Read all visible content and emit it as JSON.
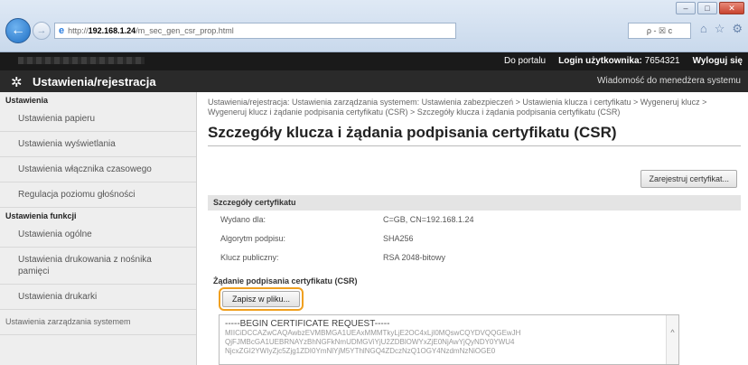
{
  "browser": {
    "url_prefix": "http://",
    "url_host": "192.168.1.24",
    "url_path": "/m_sec_gen_csr_prop.html",
    "address_tools": "ρ - ☒ c"
  },
  "topbar": {
    "portal_link": "Do portalu",
    "login_label": "Login użytkownika:",
    "login_value": "7654321",
    "logout": "Wyloguj się"
  },
  "header": {
    "title": "Ustawienia/rejestracja",
    "admin_message": "Wiadomość do menedżera systemu"
  },
  "sidebar": {
    "sections": [
      {
        "heading": "Ustawienia",
        "items": [
          "Ustawienia papieru",
          "Ustawienia wyświetlania",
          "Ustawienia włącznika czasowego",
          "Regulacja poziomu głośności"
        ]
      },
      {
        "heading": "Ustawienia funkcji",
        "items": [
          "Ustawienia ogólne",
          "Ustawienia drukowania z nośnika pamięci",
          "Ustawienia drukarki"
        ]
      }
    ],
    "bottom_item": "Ustawienia zarządzania systemem"
  },
  "main": {
    "breadcrumb": "Ustawienia/rejestracja: Ustawienia zarządzania systemem: Ustawienia zabezpieczeń > Ustawienia klucza i certyfikatu > Wygeneruj klucz > Wygeneruj klucz i żądanie podpisania certyfikatu (CSR) > Szczegóły klucza i żądania podpisania certyfikatu (CSR)",
    "page_title": "Szczegóły klucza i żądania podpisania certyfikatu (CSR)",
    "register_button": "Zarejestruj certyfikat...",
    "cert_section": "Szczegóły certyfikatu",
    "rows": [
      {
        "key": "Wydano dla:",
        "value": "C=GB, CN=192.168.1.24"
      },
      {
        "key": "Algorytm podpisu:",
        "value": "SHA256"
      },
      {
        "key": "Klucz publiczny:",
        "value": "RSA 2048-bitowy"
      }
    ],
    "csr_heading": "Żądanie podpisania certyfikatu (CSR)",
    "save_button": "Zapisz w pliku...",
    "csr_begin": "-----BEGIN CERTIFICATE REQUEST-----",
    "csr_lines": [
      "MIICiDCCAZwCAQAwbzEVMBMGA1UEAxMMMTkyLjE2OC4xLjI0MQswCQYDVQQGEwJH",
      "QjFJMBcGA1UEBRNAYzBhNGFkNmUDMGViYjU2ZDBlOWYxZjE0NjAwYjQyNDY0YWU4",
      "NjcxZGI2YWIyZjc5Zjg1ZDI0YmNlYjM5YThlNGQ4ZDczNzQ1OGY4NzdmNzNiOGE0"
    ]
  }
}
